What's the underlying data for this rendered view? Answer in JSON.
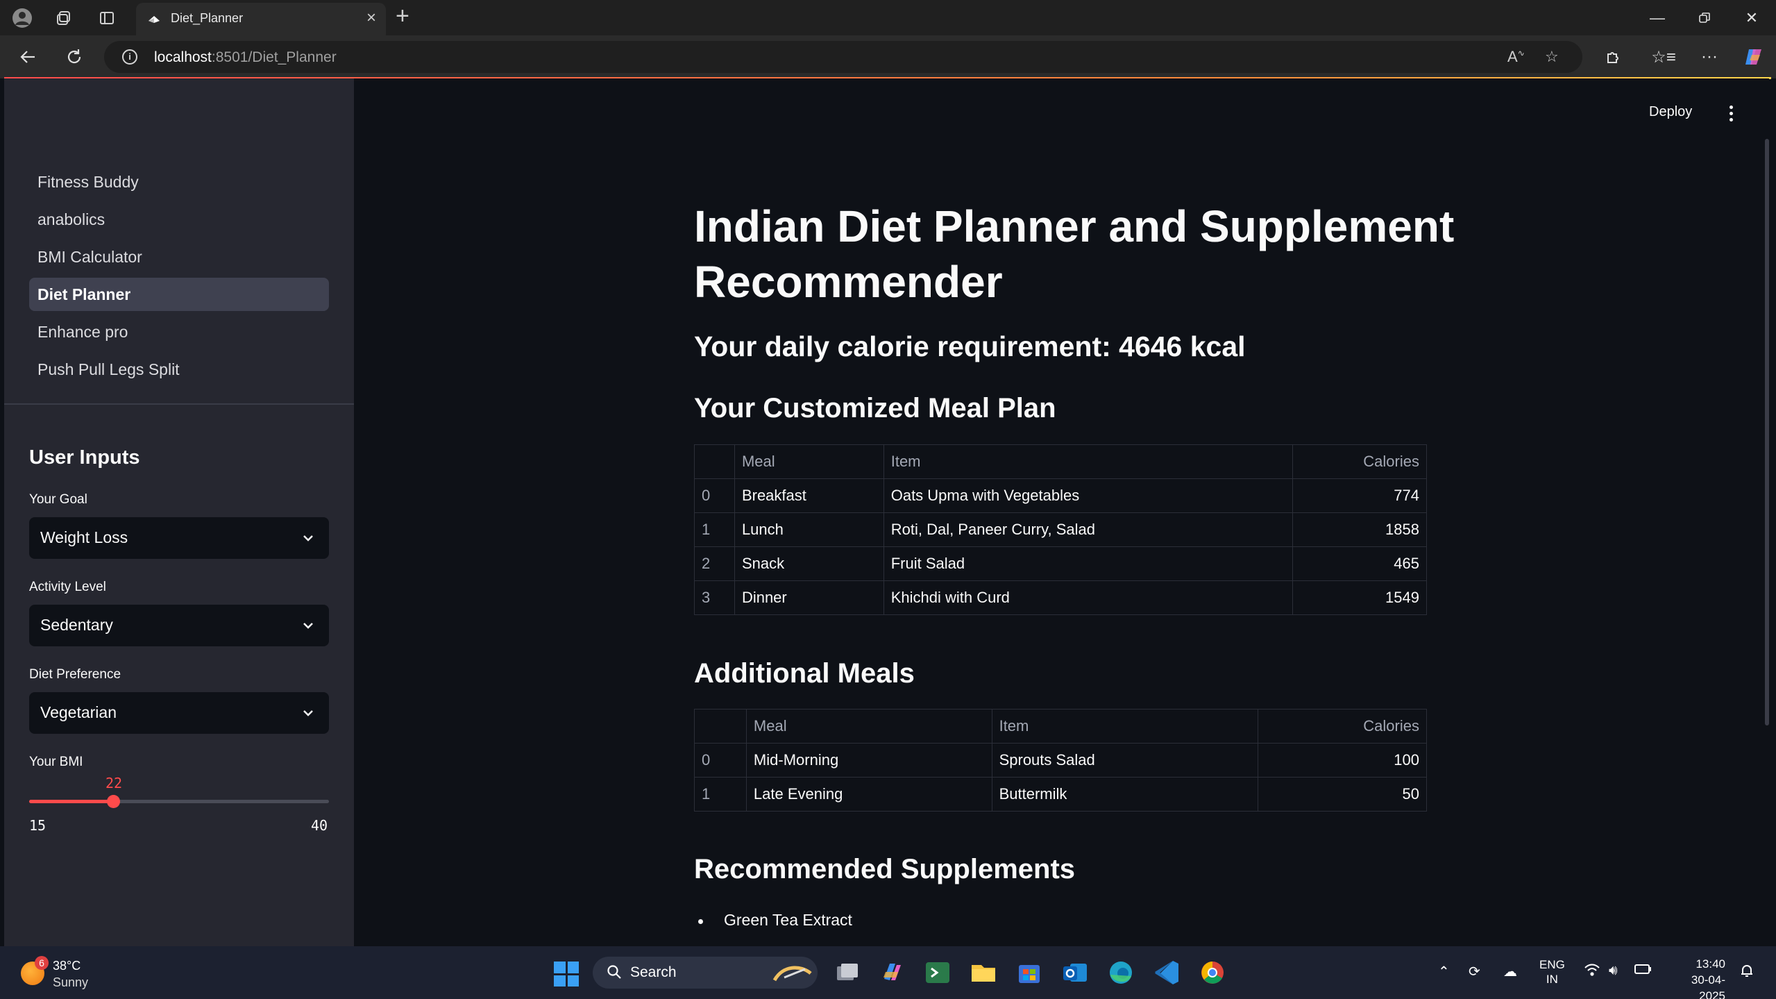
{
  "browser": {
    "tab_title": "Diet_Planner",
    "url_host": "localhost",
    "url_path": ":8501/Diet_Planner"
  },
  "app": {
    "deploy_label": "Deploy",
    "nav": [
      {
        "label": "Fitness Buddy",
        "active": false
      },
      {
        "label": "anabolics",
        "active": false
      },
      {
        "label": "BMI Calculator",
        "active": false
      },
      {
        "label": "Diet Planner",
        "active": true
      },
      {
        "label": "Enhance pro",
        "active": false
      },
      {
        "label": "Push Pull Legs Split",
        "active": false
      }
    ],
    "inputs": {
      "header": "User Inputs",
      "goal_label": "Your Goal",
      "goal_value": "Weight Loss",
      "activity_label": "Activity Level",
      "activity_value": "Sedentary",
      "diet_label": "Diet Preference",
      "diet_value": "Vegetarian",
      "bmi_label": "Your BMI",
      "bmi_value": "22",
      "bmi_min": "15",
      "bmi_max": "40",
      "accent": "#ff4b4b"
    },
    "main": {
      "title": "Indian Diet Planner and Supplement Recommender",
      "calorie_heading": "Your daily calorie requirement: 4646 kcal",
      "meal_plan_heading": "Your Customized Meal Plan",
      "additional_heading": "Additional Meals",
      "supplements_heading": "Recommended Supplements",
      "table_headers": [
        "",
        "Meal",
        "Item",
        "Calories"
      ],
      "meal_plan": [
        {
          "idx": "0",
          "meal": "Breakfast",
          "item": "Oats Upma with Vegetables",
          "calories": "774"
        },
        {
          "idx": "1",
          "meal": "Lunch",
          "item": "Roti, Dal, Paneer Curry, Salad",
          "calories": "1858"
        },
        {
          "idx": "2",
          "meal": "Snack",
          "item": "Fruit Salad",
          "calories": "465"
        },
        {
          "idx": "3",
          "meal": "Dinner",
          "item": "Khichdi with Curd",
          "calories": "1549"
        }
      ],
      "additional_meals": [
        {
          "idx": "0",
          "meal": "Mid-Morning",
          "item": "Sprouts Salad",
          "calories": "100"
        },
        {
          "idx": "1",
          "meal": "Late Evening",
          "item": "Buttermilk",
          "calories": "50"
        }
      ],
      "supplements": [
        "Green Tea Extract"
      ]
    }
  },
  "taskbar": {
    "weather_badge": "6",
    "weather_temp": "38°C",
    "weather_cond": "Sunny",
    "search_label": "Search",
    "lang_1": "ENG",
    "lang_2": "IN",
    "time": "13:40",
    "date": "30-04-2025"
  }
}
